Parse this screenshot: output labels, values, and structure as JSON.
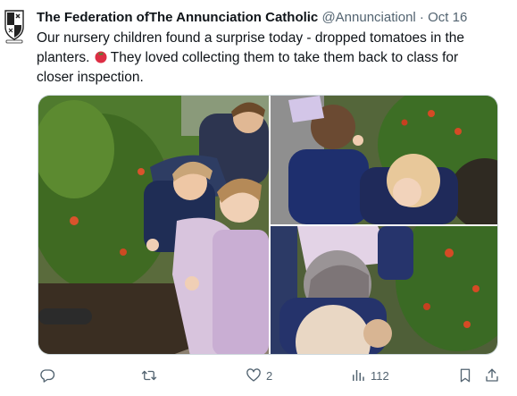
{
  "tweet": {
    "display_name": "The Federation ofThe Annunciation Catholic",
    "handle": "@Annunciationl",
    "separator": "·",
    "date": "Oct 16",
    "text_line1": "Our nursery children found a surprise today - dropped tomatoes in the",
    "text_line2_before_emoji": "planters. ",
    "text_line2_after_emoji": "They loved collecting them to take them back to class for",
    "text_line3": "closer inspection."
  },
  "media": {
    "photo_count": 3
  },
  "actions": {
    "reply_count": "",
    "retweet_count": "",
    "like_count": "2",
    "views_count": "112"
  },
  "icons": {
    "avatar": "school-crest-icon",
    "emoji": "tomato-emoji-icon",
    "reply": "reply-icon",
    "retweet": "retweet-icon",
    "like": "heart-icon",
    "views": "views-chart-icon",
    "bookmark": "bookmark-icon",
    "share": "share-icon"
  },
  "colors": {
    "text": "#0f1419",
    "secondary": "#536471",
    "border": "#cfd9de"
  }
}
